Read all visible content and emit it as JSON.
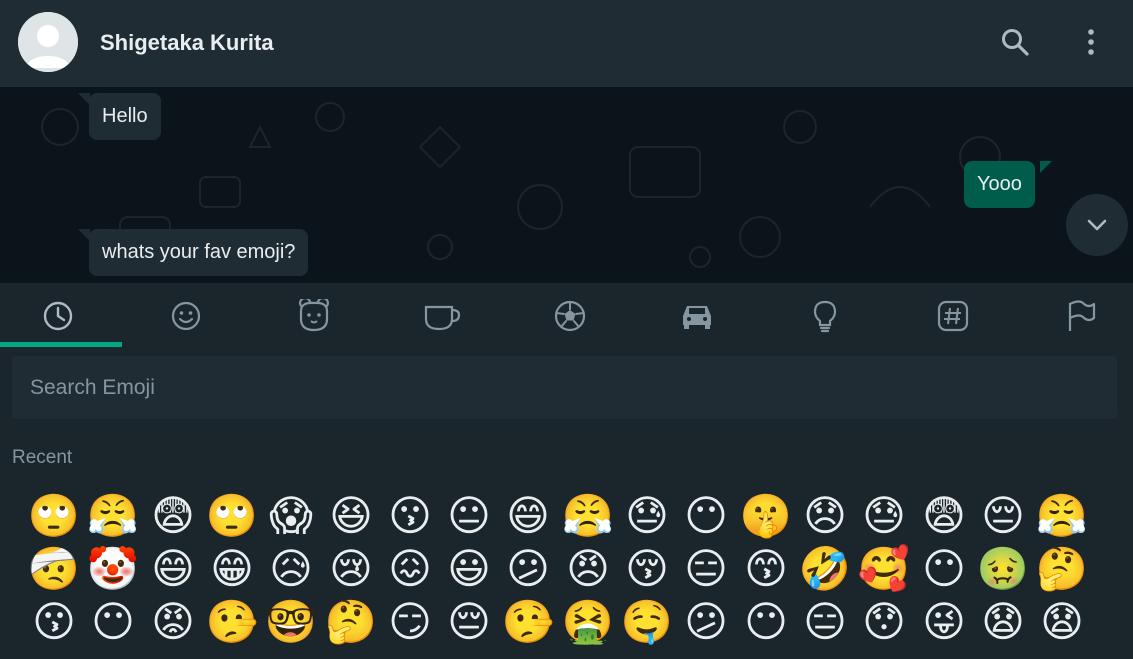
{
  "header": {
    "contact_name": "Shigetaka Kurita",
    "icons": [
      "search-icon",
      "menu-icon"
    ]
  },
  "chat": {
    "messages": [
      {
        "direction": "in",
        "text": "Hello"
      },
      {
        "direction": "out",
        "text": "Yooo"
      },
      {
        "direction": "in",
        "text": "whats your fav emoji?"
      }
    ]
  },
  "emoji_panel": {
    "categories": [
      "recent-icon",
      "smileys-icon",
      "animals-icon",
      "food-icon",
      "activity-icon",
      "travel-icon",
      "objects-icon",
      "symbols-icon",
      "flags-icon"
    ],
    "active_category": 0,
    "search_placeholder": "Search Emoji",
    "section_label": "Recent",
    "emojis": [
      [
        "🙄",
        "😤",
        "😨",
        "🙄",
        "😱",
        "😆",
        "😗",
        "😐",
        "😄",
        "😤",
        "😓",
        "😶",
        "🤫",
        "😞",
        "😓",
        "😨",
        "😔",
        "😤"
      ],
      [
        "🤕",
        "🤡",
        "😄",
        "😁",
        "😥",
        "😢",
        "😖",
        "😃",
        "😕",
        "😠",
        "😚",
        "😑",
        "😙",
        "🤣",
        "🥰",
        "😶",
        "🤢",
        "🤔"
      ],
      [
        "😗",
        "😶",
        "😡",
        "🤥",
        "🤓",
        "🤔",
        "😏",
        "😔",
        "🤥",
        "🤮",
        "🤤",
        "😕",
        "😶",
        "😑",
        "😯",
        "😜",
        "😧",
        "😧"
      ]
    ]
  },
  "colors": {
    "header_bg": "#202c33",
    "chat_bg": "#0b141a",
    "incoming_bubble": "#202c33",
    "outgoing_bubble": "#005c4b",
    "accent": "#00a884",
    "panel_bg": "#1b262c"
  }
}
